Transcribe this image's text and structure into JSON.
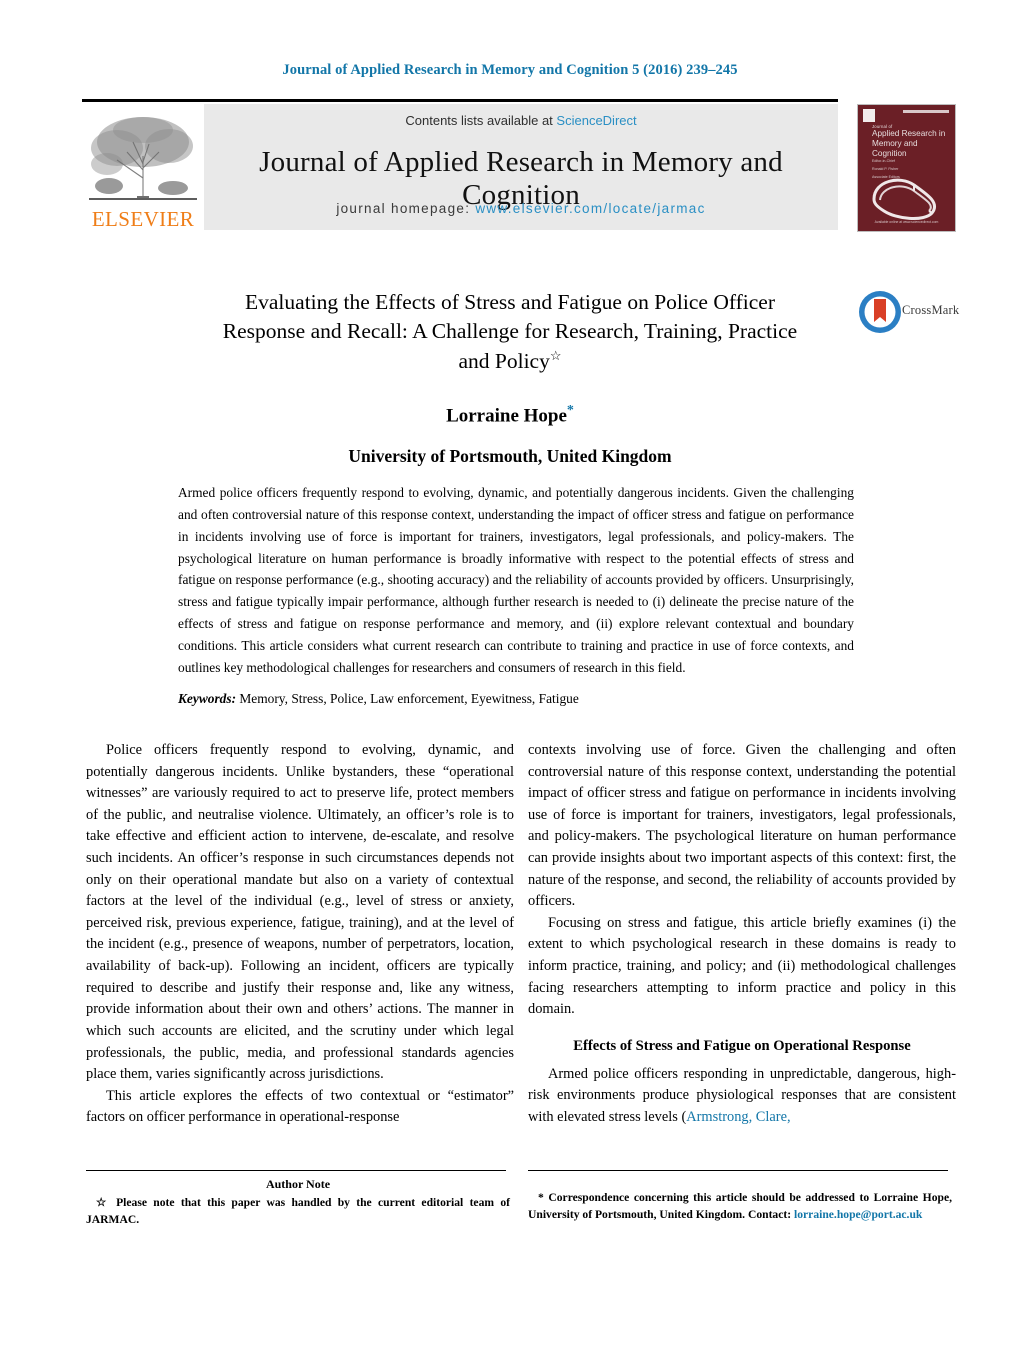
{
  "running_head": "Journal of Applied Research in Memory and Cognition 5 (2016) 239–245",
  "masthead": {
    "publisher_name": "ELSEVIER",
    "publisher_logo_icon": "elsevier-tree-icon",
    "contents_prefix": "Contents lists available at",
    "contents_link": "ScienceDirect",
    "journal_title": "Journal of Applied Research in Memory and Cognition",
    "homepage_label": "journal homepage:",
    "homepage_url": "www.elsevier.com/locate/jarmac",
    "cover": {
      "line1": "Journal of",
      "line2": "Applied Research in",
      "line3": "Memory and Cognition",
      "meta1": "Editor-in-Chief",
      "meta2": "Ronald P. Fisher",
      "meta3": "Associate Editors",
      "footer": "Available online at www.sciencedirect.com",
      "icon": "mobius-strip-icon"
    }
  },
  "article": {
    "title_line1": "Evaluating the Effects of Stress and Fatigue on Police Officer",
    "title_line2": "Response and Recall: A Challenge for Research, Training, Practice",
    "title_line3": "and Policy",
    "title_footnote_marker": "☆",
    "author": "Lorraine Hope",
    "author_footnote_marker": "*",
    "affiliation": "University of Portsmouth, United Kingdom"
  },
  "crossmark": {
    "label": "CrossMark",
    "icon": "crossmark-icon",
    "ring_color": "#2b7fc4",
    "ribbon_color": "#d93f26"
  },
  "abstract": {
    "text": "Armed police officers frequently respond to evolving, dynamic, and potentially dangerous incidents. Given the challenging and often controversial nature of this response context, understanding the impact of officer stress and fatigue on performance in incidents involving use of force is important for trainers, investigators, legal professionals, and policy-makers. The psychological literature on human performance is broadly informative with respect to the potential effects of stress and fatigue on response performance (e.g., shooting accuracy) and the reliability of accounts provided by officers. Unsurprisingly, stress and fatigue typically impair performance, although further research is needed to (i) delineate the precise nature of the effects of stress and fatigue on response performance and memory, and (ii) explore relevant contextual and boundary conditions. This article considers what current research can contribute to training and practice in use of force contexts, and outlines key methodological challenges for researchers and consumers of research in this field."
  },
  "keywords": {
    "label": "Keywords:",
    "value": "Memory, Stress, Police, Law enforcement, Eyewitness, Fatigue"
  },
  "body": {
    "left_p1": "Police officers frequently respond to evolving, dynamic, and potentially dangerous incidents. Unlike bystanders, these “operational witnesses” are variously required to act to preserve life, protect members of the public, and neutralise violence. Ultimately, an officer’s role is to take effective and efficient action to intervene, de-escalate, and resolve such incidents. An officer’s response in such circumstances depends not only on their operational mandate but also on a variety of contextual factors at the level of the individual (e.g., level of stress or anxiety, perceived risk, previous experience, fatigue, training), and at the level of the incident (e.g., presence of weapons, number of perpetrators, location, availability of back-up). Following an incident, officers are typically required to describe and justify their response and, like any witness, provide information about their own and others’ actions. The manner in which such accounts are elicited, and the scrutiny under which legal professionals, the public, media, and professional standards agencies place them, varies significantly across jurisdictions.",
    "left_p2": "This article explores the effects of two contextual or “estimator” factors on officer performance in operational-response",
    "right_p1": "contexts involving use of force. Given the challenging and often controversial nature of this response context, understanding the potential impact of officer stress and fatigue on performance in incidents involving use of force is important for trainers, investigators, legal professionals, and policy-makers. The psychological literature on human performance can provide insights about two important aspects of this context: first, the nature of the response, and second, the reliability of accounts provided by officers.",
    "right_p2": "Focusing on stress and fatigue, this article briefly examines (i) the extent to which psychological research in these domains is ready to inform practice, training, and policy; and (ii) methodological challenges facing researchers attempting to inform practice and policy in this domain.",
    "section_heading": "Effects of Stress and Fatigue on Operational Response",
    "right_p3_before": "Armed police officers responding in unpredictable, dangerous, high-risk environments produce physiological responses that are consistent with elevated stress levels (",
    "right_p3_citation": "Armstrong, Clare,"
  },
  "footnotes": {
    "left_title": "Author Note",
    "left_marker": "☆",
    "left_text": "Please note that this paper was handled by the current editorial team of JARMAC.",
    "right_marker": "*",
    "right_text_before": "Correspondence concerning this article should be addressed to Lorraine Hope, University of Portsmouth, United Kingdom. Contact:",
    "right_email": "lorraine.hope@port.ac.uk"
  },
  "colors": {
    "link_blue": "#1276a8",
    "header_blue": "#2a8fc4",
    "elsevier_orange": "#ef7d17",
    "cover_maroon": "#6b1f26"
  }
}
